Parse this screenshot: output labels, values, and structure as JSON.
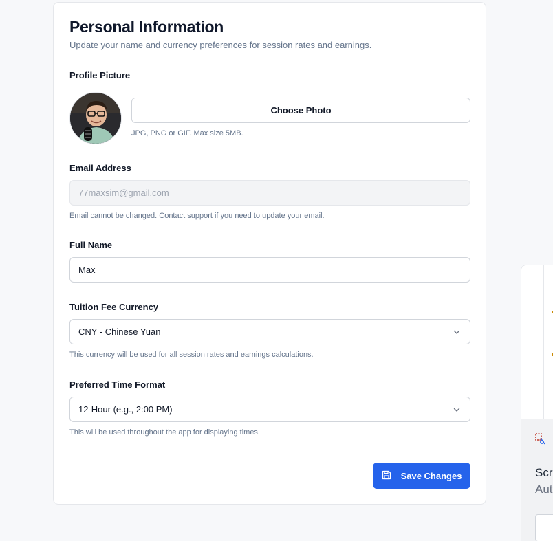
{
  "section": {
    "title": "Personal Information",
    "subtitle": "Update your name and currency preferences for session rates and earnings."
  },
  "profile_picture": {
    "label": "Profile Picture",
    "button_label": "Choose Photo",
    "hint": "JPG, PNG or GIF. Max size 5MB."
  },
  "email": {
    "label": "Email Address",
    "value": "77maxsim@gmail.com",
    "hint": "Email cannot be changed. Contact support if you need to update your email."
  },
  "full_name": {
    "label": "Full Name",
    "value": "Max"
  },
  "currency": {
    "label": "Tuition Fee Currency",
    "selected": "CNY - Chinese Yuan",
    "hint": "This currency will be used for all session rates and earnings calculations."
  },
  "time_format": {
    "label": "Preferred Time Format",
    "selected": "12-Hour (e.g., 2:00 PM)",
    "hint": "This will be used throughout the app for displaying times."
  },
  "save_button": {
    "label": "Save Changes"
  },
  "notification": {
    "title": "Scre",
    "subtitle": "Aut"
  },
  "colors": {
    "accent": "#2563eb",
    "background": "#f7f8fa",
    "card": "#ffffff",
    "muted_text": "#64748b"
  }
}
